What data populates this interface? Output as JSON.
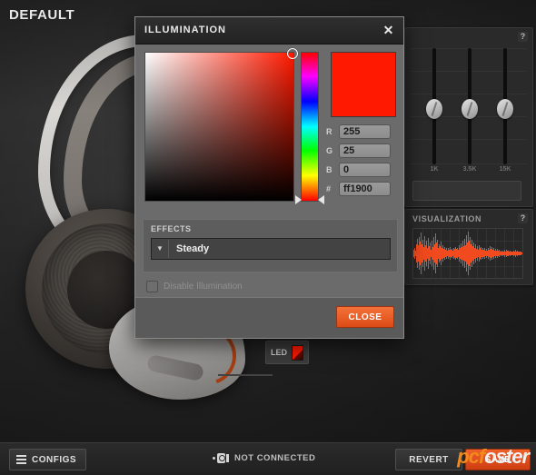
{
  "app": {
    "profile_title": "DEFAULT"
  },
  "equalizer": {
    "help_icon": "question-mark-icon",
    "bands": [
      {
        "label": "1K"
      },
      {
        "label": "3.5K"
      },
      {
        "label": "15K"
      }
    ]
  },
  "visualization": {
    "title": "VISUALIZATION",
    "help_icon": "question-mark-icon",
    "waveform": [
      12,
      20,
      9,
      34,
      52,
      28,
      60,
      41,
      74,
      33,
      50,
      22,
      62,
      30,
      44,
      18,
      55,
      26,
      38,
      14,
      46,
      24,
      58,
      31,
      70,
      40,
      50,
      20,
      33,
      27,
      41,
      19,
      30,
      16,
      24,
      12,
      20,
      10,
      18,
      14,
      22,
      13,
      17,
      11,
      19,
      15,
      23,
      16,
      20,
      12,
      28,
      18,
      36,
      22,
      44,
      26,
      52,
      30,
      66,
      38,
      78,
      44,
      60,
      34,
      48,
      26,
      40,
      20,
      32,
      17,
      26,
      14,
      30,
      19,
      24,
      13,
      21,
      12,
      18,
      10,
      16,
      9,
      20,
      13,
      25,
      15,
      22,
      12,
      19,
      11,
      17,
      10,
      15,
      9,
      13,
      8,
      11,
      7,
      10,
      6,
      12,
      8,
      14,
      9,
      11,
      7,
      9,
      6,
      8,
      5,
      10,
      7,
      12,
      8,
      9,
      6,
      7,
      5,
      6,
      4,
      8,
      6,
      7,
      5
    ]
  },
  "led_chip": {
    "label": "LED",
    "swatch_color": "#ff1900"
  },
  "bottom_bar": {
    "configs_label": "CONFIGS",
    "configs_icon": "list-icon",
    "connection_icon": "usb-disconnected-icon",
    "connection_status": "NOT CONNECTED",
    "revert_label": "REVERT",
    "save_label": "SAVE",
    "watermark": {
      "part1": "pc",
      "part2": "f",
      "part3": "oster"
    }
  },
  "dialog": {
    "title": "ILLUMINATION",
    "close_icon": "✕",
    "picker": {
      "selected_color": "#ff1900",
      "fields": [
        {
          "label": "R",
          "value": "255"
        },
        {
          "label": "G",
          "value": "25"
        },
        {
          "label": "B",
          "value": "0"
        },
        {
          "label": "#",
          "value": "ff1900"
        }
      ],
      "swatches": [
        "#ff1900",
        "",
        "",
        "",
        "",
        "",
        "",
        "",
        ""
      ],
      "more_swatches_icon": "chevron-down-icon"
    },
    "effects": {
      "section_label": "EFFECTS",
      "selected": "Steady",
      "caret_icon": "caret-down-icon"
    },
    "disable": {
      "label": "Disable Illumination",
      "checked": false
    },
    "close_button_label": "CLOSE"
  }
}
